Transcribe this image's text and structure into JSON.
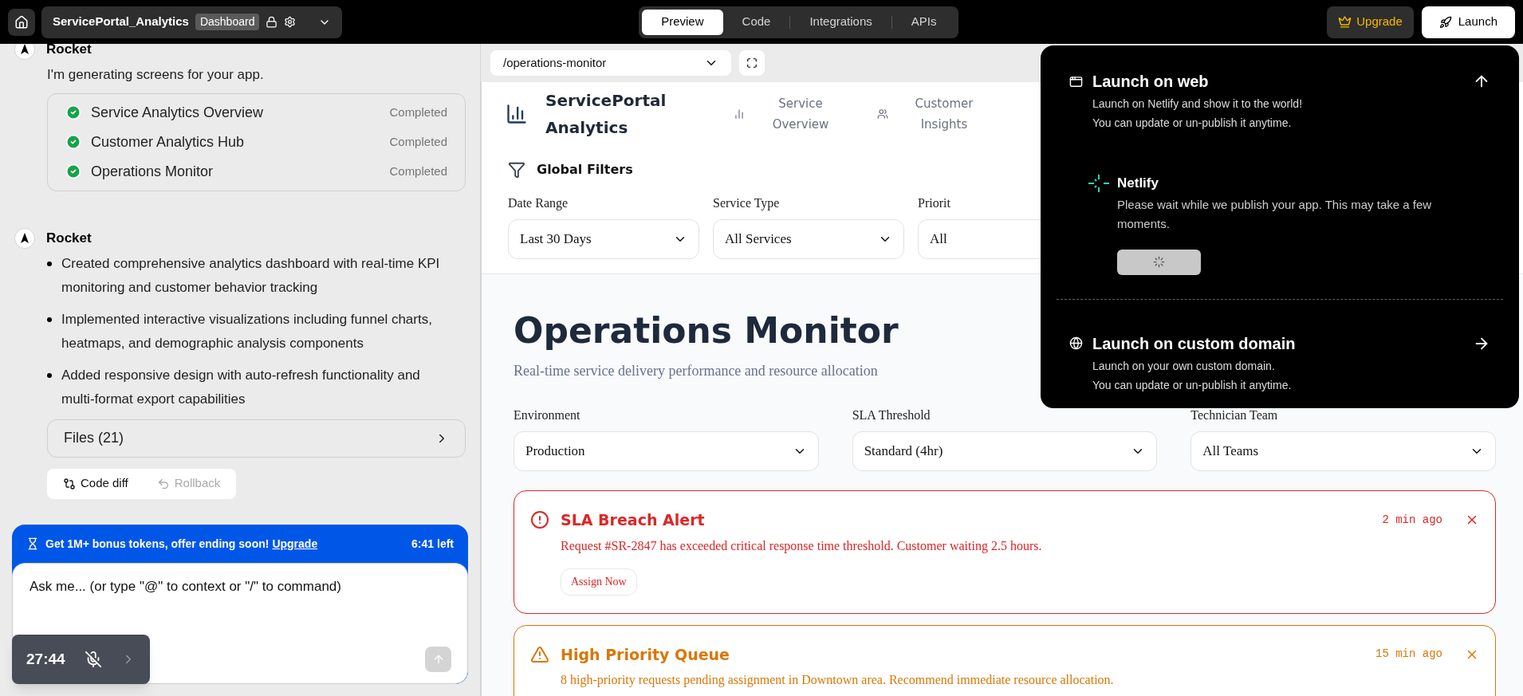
{
  "top_bar": {
    "project_name": "ServicePortal_Analytics",
    "badge": "Dashboard",
    "tabs": [
      {
        "label": "Preview",
        "selected": true
      },
      {
        "label": "Code",
        "selected": false
      },
      {
        "label": "Integrations",
        "selected": false
      },
      {
        "label": "APIs",
        "selected": false
      }
    ],
    "upgrade": "Upgrade",
    "launch": "Launch"
  },
  "chat": {
    "messages": [
      {
        "author": "Rocket",
        "text": "I'm generating screens for your app.",
        "tasks": [
          {
            "label": "Service Analytics Overview",
            "status": "Completed",
            "done": true
          },
          {
            "label": "Customer Analytics Hub",
            "status": "Completed",
            "done": true
          },
          {
            "label": "Operations Monitor",
            "status": "Completed",
            "done": true
          }
        ]
      },
      {
        "author": "Rocket",
        "bullets": [
          "Created comprehensive analytics dashboard with real-time KPI monitoring and customer behavior tracking",
          "Implemented interactive visualizations including funnel charts, heatmaps, and demographic analysis components",
          "Added responsive design with auto-refresh functionality and multi-format export capabilities"
        ]
      }
    ],
    "files": "Files (21)",
    "actions": [
      {
        "kind": "diff",
        "label": "Code diff",
        "disabled": false
      },
      {
        "kind": "rollback",
        "label": "Rollback",
        "disabled": true
      }
    ],
    "promo": {
      "text": "Get 1M+ bonus tokens, offer ending soon!",
      "link": "Upgrade",
      "time_left": "6:41 left"
    },
    "input": {
      "placeholder": "Ask me... (or type \"@\" to context or \"/\" to command)"
    },
    "recorder": {
      "time": "27:44",
      "muted": true
    }
  },
  "preview": {
    "route": "/operations-monitor",
    "app": {
      "title": "ServicePortal Analytics",
      "nav": [
        {
          "kind": "chart",
          "label": "Service Overview"
        },
        {
          "kind": "users",
          "label": "Customer Insights"
        }
      ]
    },
    "filters": {
      "title": "Global Filters",
      "fields": [
        {
          "label": "Date Range",
          "value": "Last 30 Days"
        },
        {
          "label": "Service Type",
          "value": "All Services"
        },
        {
          "label": "Priorit",
          "value": "All"
        }
      ]
    },
    "page": {
      "title": "Operations Monitor",
      "subtitle": "Real-time service delivery performance and resource allocation",
      "selects": [
        {
          "label": "Environment",
          "value": "Production"
        },
        {
          "label": "SLA Threshold",
          "value": "Standard (4hr)"
        },
        {
          "label": "Technician Team",
          "value": "All Teams"
        }
      ],
      "alerts": [
        {
          "kind": "error",
          "title": "SLA Breach Alert",
          "message": "Request #SR-2847 has exceeded critical response time threshold. Customer waiting 2.5 hours.",
          "time": "2 min ago",
          "action": "Assign Now"
        },
        {
          "kind": "warning",
          "title": "High Priority Queue",
          "message": "8 high-priority requests pending assignment in Downtown area. Recommend immediate resource allocation.",
          "time": "15 min ago"
        }
      ]
    }
  },
  "launch_menu": {
    "web": {
      "title": "Launch on web",
      "lines": [
        "Launch on Netlify and show it to the world!",
        "You can update or un-publish it anytime."
      ],
      "provider": {
        "name": "Netlify",
        "message": "Please wait while we publish your app. This may take a few moments.",
        "loading": true
      }
    },
    "custom": {
      "title": "Launch on custom domain",
      "lines": [
        "Launch on your own custom domain.",
        "You can update or un-publish it anytime."
      ]
    }
  }
}
